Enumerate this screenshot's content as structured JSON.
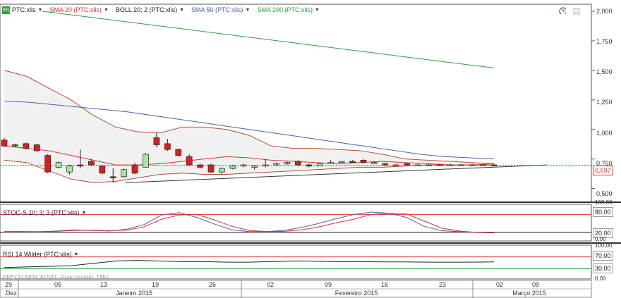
{
  "main_panel": {
    "legend": [
      {
        "label": "PTC:xlis",
        "color": "#222222"
      },
      {
        "label": "SMA 20 (PTC:xlis)",
        "color": "#e03030"
      },
      {
        "label": "BOLL 20; 2 (PTC:xlis)",
        "color": "#222222"
      },
      {
        "label": "SMA 50 (PTC:xlis)",
        "color": "#4a5fb0"
      },
      {
        "label": "SMA 200 (PTC:xlis)",
        "color": "#2aa040"
      }
    ],
    "y_ticks": [
      "2,000",
      "1,750",
      "1,500",
      "1,250",
      "1,000",
      "0,750",
      "0,500"
    ],
    "last_price_label": "0,697",
    "watermark": "PREÇO INDICATIVO - Fuso horário: TMG"
  },
  "stoch_panel": {
    "legend": "STOC-S 10; 3; 3 (PTC:xlis)",
    "y_ticks": [
      "100,00",
      "80,00",
      "20,00",
      "0,00"
    ]
  },
  "rsi_panel": {
    "legend": "RSI 14 Wilder (PTC:xlis)",
    "y_ticks": [
      "100,00",
      "70,00",
      "30,00",
      "0,00"
    ]
  },
  "x_axis": {
    "day_labels": [
      "29",
      "05",
      "13",
      "19",
      "26",
      "02",
      "09",
      "16",
      "23",
      "02",
      "09"
    ],
    "month_labels": [
      "Dez",
      "Janeiro 2015",
      "Fevereiro 2015",
      "Março 2015"
    ]
  },
  "chart_data": {
    "type": "candlestick",
    "x_dates": [
      "2014-12-29",
      "2014-12-31",
      "2015-01-02",
      "2015-01-05",
      "2015-01-06",
      "2015-01-07",
      "2015-01-08",
      "2015-01-09",
      "2015-01-12",
      "2015-01-13",
      "2015-01-14",
      "2015-01-15",
      "2015-01-16",
      "2015-01-19",
      "2015-01-20",
      "2015-01-21",
      "2015-01-22",
      "2015-01-23",
      "2015-01-26",
      "2015-01-27",
      "2015-01-28",
      "2015-01-29",
      "2015-01-30",
      "2015-02-02",
      "2015-02-03",
      "2015-02-04",
      "2015-02-05",
      "2015-02-06",
      "2015-02-09",
      "2015-02-10",
      "2015-02-11",
      "2015-02-12",
      "2015-02-13",
      "2015-02-16",
      "2015-02-17",
      "2015-02-18",
      "2015-02-19",
      "2015-02-20",
      "2015-02-23",
      "2015-02-24",
      "2015-02-25",
      "2015-02-26",
      "2015-02-27",
      "2015-03-02",
      "2015-03-03",
      "2015-03-04"
    ],
    "candles": [
      {
        "o": 0.91,
        "h": 0.93,
        "l": 0.85,
        "c": 0.86
      },
      {
        "o": 0.87,
        "h": 0.88,
        "l": 0.85,
        "c": 0.86
      },
      {
        "o": 0.88,
        "h": 0.89,
        "l": 0.83,
        "c": 0.84
      },
      {
        "o": 0.87,
        "h": 0.88,
        "l": 0.81,
        "c": 0.82
      },
      {
        "o": 0.78,
        "h": 0.79,
        "l": 0.63,
        "c": 0.64
      },
      {
        "o": 0.68,
        "h": 0.73,
        "l": 0.67,
        "c": 0.72
      },
      {
        "o": 0.64,
        "h": 0.7,
        "l": 0.62,
        "c": 0.69
      },
      {
        "o": 0.7,
        "h": 0.83,
        "l": 0.67,
        "c": 0.69
      },
      {
        "o": 0.73,
        "h": 0.75,
        "l": 0.69,
        "c": 0.7
      },
      {
        "o": 0.69,
        "h": 0.7,
        "l": 0.62,
        "c": 0.63
      },
      {
        "o": 0.6,
        "h": 0.67,
        "l": 0.55,
        "c": 0.59
      },
      {
        "o": 0.6,
        "h": 0.67,
        "l": 0.59,
        "c": 0.66
      },
      {
        "o": 0.7,
        "h": 0.72,
        "l": 0.62,
        "c": 0.63
      },
      {
        "o": 0.68,
        "h": 0.8,
        "l": 0.68,
        "c": 0.79
      },
      {
        "o": 0.93,
        "h": 0.97,
        "l": 0.85,
        "c": 0.87
      },
      {
        "o": 0.88,
        "h": 0.92,
        "l": 0.82,
        "c": 0.83
      },
      {
        "o": 0.83,
        "h": 0.84,
        "l": 0.77,
        "c": 0.78
      },
      {
        "o": 0.77,
        "h": 0.79,
        "l": 0.69,
        "c": 0.7
      },
      {
        "o": 0.7,
        "h": 0.71,
        "l": 0.67,
        "c": 0.68
      },
      {
        "o": 0.7,
        "h": 0.71,
        "l": 0.63,
        "c": 0.64
      },
      {
        "o": 0.64,
        "h": 0.68,
        "l": 0.62,
        "c": 0.67
      },
      {
        "o": 0.67,
        "h": 0.7,
        "l": 0.66,
        "c": 0.69
      },
      {
        "o": 0.69,
        "h": 0.71,
        "l": 0.68,
        "c": 0.7
      },
      {
        "o": 0.68,
        "h": 0.7,
        "l": 0.66,
        "c": 0.69
      },
      {
        "o": 0.69,
        "h": 0.75,
        "l": 0.68,
        "c": 0.7
      },
      {
        "o": 0.7,
        "h": 0.72,
        "l": 0.69,
        "c": 0.71
      },
      {
        "o": 0.71,
        "h": 0.73,
        "l": 0.7,
        "c": 0.72
      },
      {
        "o": 0.73,
        "h": 0.74,
        "l": 0.69,
        "c": 0.7
      },
      {
        "o": 0.7,
        "h": 0.71,
        "l": 0.68,
        "c": 0.69
      },
      {
        "o": 0.69,
        "h": 0.72,
        "l": 0.69,
        "c": 0.71
      },
      {
        "o": 0.72,
        "h": 0.74,
        "l": 0.71,
        "c": 0.72
      },
      {
        "o": 0.72,
        "h": 0.73,
        "l": 0.72,
        "c": 0.73
      },
      {
        "o": 0.73,
        "h": 0.74,
        "l": 0.72,
        "c": 0.72
      },
      {
        "o": 0.74,
        "h": 0.75,
        "l": 0.71,
        "c": 0.72
      },
      {
        "o": 0.72,
        "h": 0.73,
        "l": 0.71,
        "c": 0.72
      },
      {
        "o": 0.71,
        "h": 0.72,
        "l": 0.69,
        "c": 0.7
      },
      {
        "o": 0.7,
        "h": 0.71,
        "l": 0.69,
        "c": 0.7
      },
      {
        "o": 0.71,
        "h": 0.72,
        "l": 0.69,
        "c": 0.7
      },
      {
        "o": 0.7,
        "h": 0.71,
        "l": 0.69,
        "c": 0.7
      },
      {
        "o": 0.7,
        "h": 0.71,
        "l": 0.69,
        "c": 0.7
      },
      {
        "o": 0.7,
        "h": 0.71,
        "l": 0.69,
        "c": 0.7
      },
      {
        "o": 0.7,
        "h": 0.71,
        "l": 0.69,
        "c": 0.7
      },
      {
        "o": 0.7,
        "h": 0.71,
        "l": 0.69,
        "c": 0.7
      },
      {
        "o": 0.7,
        "h": 0.71,
        "l": 0.69,
        "c": 0.7
      },
      {
        "o": 0.7,
        "h": 0.71,
        "l": 0.69,
        "c": 0.7
      },
      {
        "o": 0.7,
        "h": 0.71,
        "l": 0.69,
        "c": 0.697
      }
    ],
    "sma200": {
      "start": 2.0,
      "end": 1.52
    },
    "sma50": [
      1.24,
      1.23,
      1.21,
      1.19,
      1.17,
      1.15,
      1.12,
      1.09,
      1.06,
      1.03,
      1.0,
      0.97,
      0.94,
      0.91,
      0.88,
      0.85,
      0.82,
      0.79,
      0.77,
      0.76,
      0.75
    ],
    "sma20": [
      0.86,
      0.84,
      0.82,
      0.78,
      0.74,
      0.7,
      0.7,
      0.71,
      0.73,
      0.75,
      0.77,
      0.76,
      0.74,
      0.73,
      0.72,
      0.71,
      0.72,
      0.73,
      0.72,
      0.71,
      0.7,
      0.7,
      0.7
    ],
    "boll_upper": [
      1.5,
      1.45,
      1.35,
      1.25,
      1.12,
      1.02,
      0.98,
      0.97,
      1.02,
      1.02,
      1.0,
      0.95,
      0.86,
      0.84,
      0.84,
      0.83,
      0.82,
      0.79,
      0.75,
      0.74,
      0.73,
      0.72,
      0.71
    ],
    "boll_lower": [
      0.74,
      0.72,
      0.65,
      0.58,
      0.55,
      0.56,
      0.59,
      0.62,
      0.63,
      0.62,
      0.62,
      0.63,
      0.64,
      0.65,
      0.66,
      0.67,
      0.68,
      0.68,
      0.69,
      0.7,
      0.7,
      0.7,
      0.71
    ],
    "last_price": 0.697,
    "ylim": [
      0.45,
      2.0
    ],
    "stochastic": {
      "k": [
        22,
        22,
        21,
        24,
        28,
        26,
        24,
        30,
        46,
        78,
        86,
        70,
        48,
        28,
        22,
        22,
        26,
        36,
        50,
        66,
        80,
        88,
        84,
        70,
        40,
        25,
        22,
        20,
        18
      ],
      "d": [
        22,
        22,
        22,
        23,
        26,
        27,
        25,
        27,
        38,
        64,
        78,
        80,
        62,
        40,
        26,
        22,
        23,
        28,
        38,
        52,
        64,
        80,
        84,
        82,
        58,
        34,
        24,
        19,
        18
      ],
      "levels": [
        80,
        20
      ]
    },
    "rsi": {
      "values": [
        34,
        36,
        38,
        40,
        48,
        56,
        58,
        56,
        54,
        54,
        52,
        52,
        54,
        56,
        55,
        54,
        54,
        53,
        53,
        52,
        52,
        52,
        53
      ],
      "levels": [
        70,
        30
      ]
    }
  }
}
